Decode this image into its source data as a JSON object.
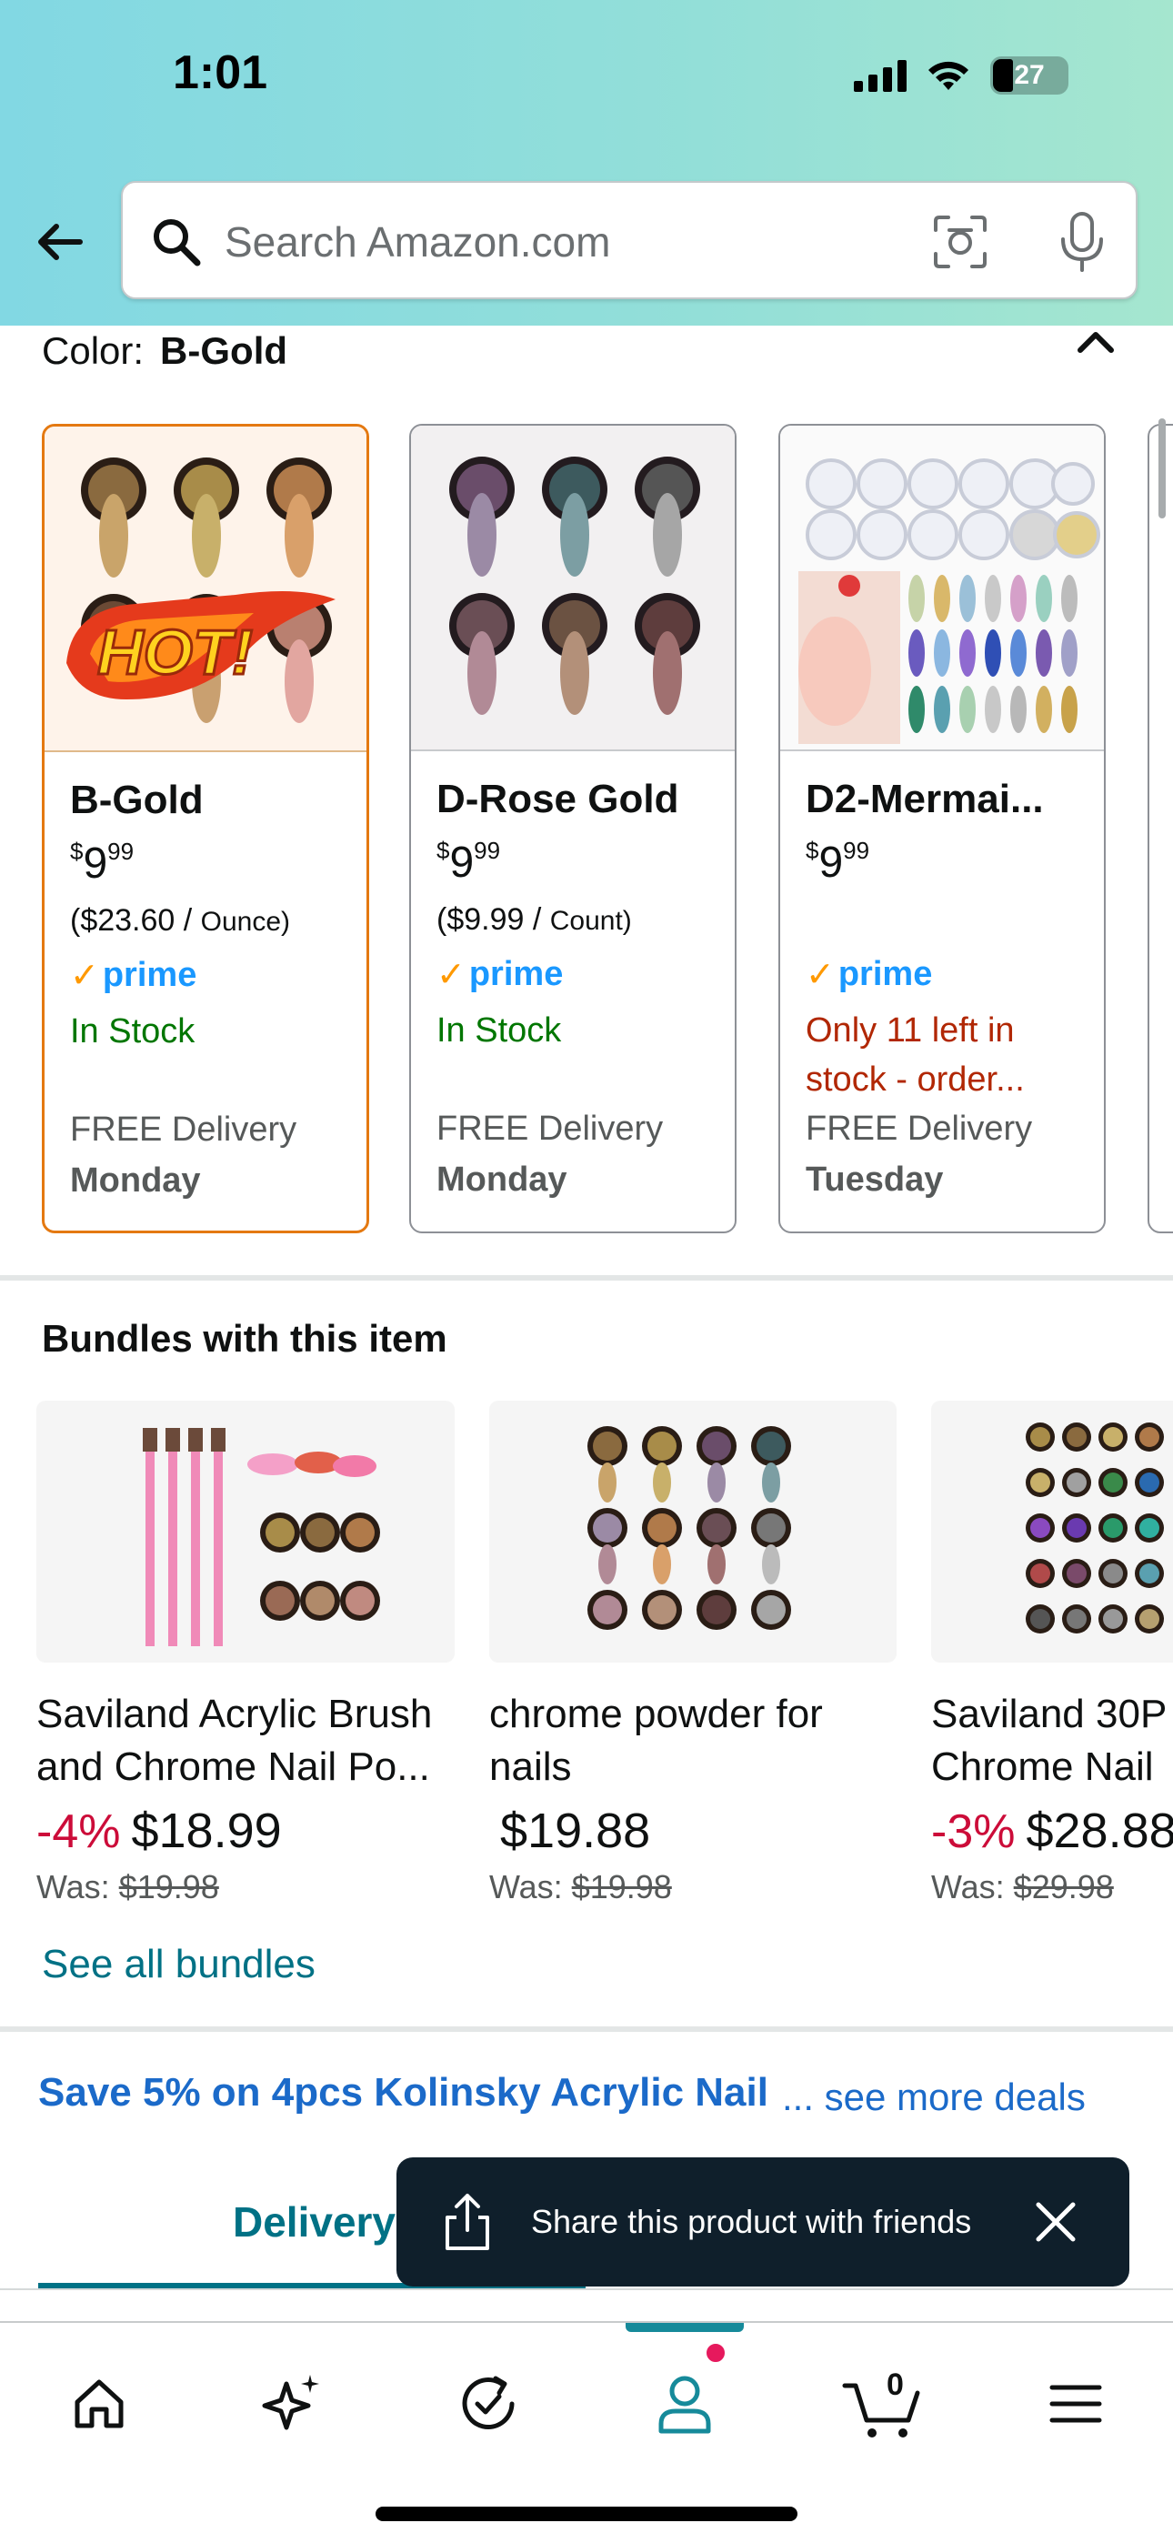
{
  "status_bar": {
    "time": "1:01",
    "battery": "27"
  },
  "search": {
    "placeholder": "Search Amazon.com"
  },
  "color_selector": {
    "label": "Color:",
    "selected": "B-Gold",
    "swatches": [
      {
        "name": "B-Gold",
        "price_whole": "9",
        "price_cents": "99",
        "unit_price": "($23.60 / ",
        "unit": "Ounce)",
        "prime": "prime",
        "stock": "In Stock",
        "delivery": "FREE Delivery",
        "day": "Monday"
      },
      {
        "name": "D-Rose Gold",
        "price_whole": "9",
        "price_cents": "99",
        "unit_price": "($9.99 / ",
        "unit": "Count)",
        "prime": "prime",
        "stock": "In Stock",
        "delivery": "FREE Delivery",
        "day": "Monday"
      },
      {
        "name": "D2-Mermai...",
        "price_whole": "9",
        "price_cents": "99",
        "unit_price": "",
        "unit": "",
        "prime": "prime",
        "stock": "Only 11 left in stock - order...",
        "delivery": "FREE Delivery",
        "day": "Tuesday"
      }
    ],
    "hot_label": "HOT!"
  },
  "bundles": {
    "title": "Bundles with this item",
    "items": [
      {
        "title": "Saviland Acrylic Brush and Chrome Nail Po...",
        "discount": "-4%",
        "price": "$18.99",
        "was_label": "Was:",
        "was_price": "$19.98"
      },
      {
        "title": "chrome powder for nails",
        "discount": "",
        "price": "$19.88",
        "was_label": "Was:",
        "was_price": "$19.98"
      },
      {
        "title": "Saviland 30P Chrome Nail",
        "discount": "-3%",
        "price": "$28.88",
        "was_label": "Was:",
        "was_price": "$29.98"
      }
    ],
    "see_all": "See all bundles"
  },
  "deal": {
    "text": "Save 5% on 4pcs Kolinsky Acrylic Nail",
    "more": "... see more deals"
  },
  "tabs": {
    "delivery": "Delivery"
  },
  "toast": {
    "text": "Share this product with friends"
  },
  "bottom_nav": {
    "cart_count": "0"
  },
  "colors": {
    "accent_teal": "#007185",
    "prime_blue": "#1a98ff",
    "in_stock": "#007600",
    "low_stock": "#b12704",
    "discount": "#cc0c39",
    "selected_border": "#e47911"
  }
}
